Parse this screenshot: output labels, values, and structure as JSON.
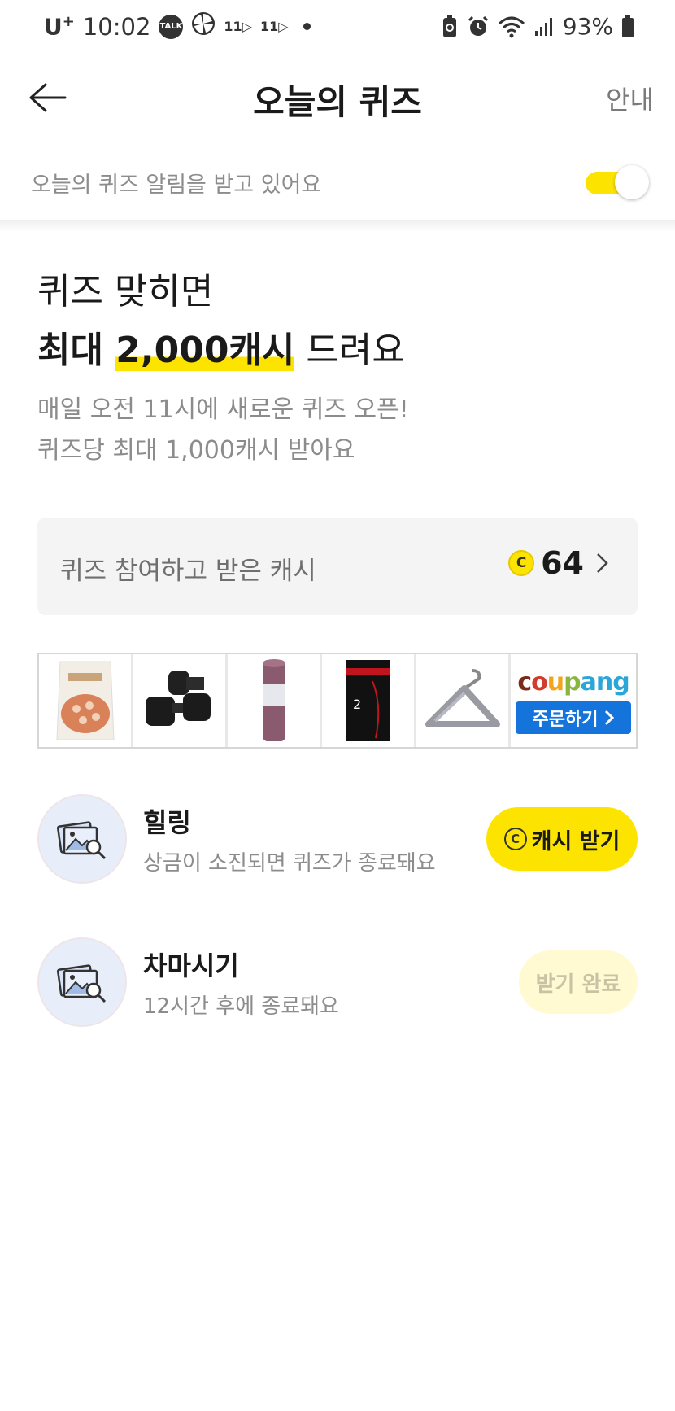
{
  "status_bar": {
    "carrier": "U",
    "carrier_sup": "+",
    "time": "10:02",
    "talk_icon_text": "TALK",
    "eleven_1": "11",
    "eleven_2": "11",
    "battery": "93%"
  },
  "header": {
    "title": "오늘의 퀴즈",
    "guide_label": "안내"
  },
  "notification": {
    "text": "오늘의 퀴즈 알림을 받고 있어요",
    "toggle_on": true
  },
  "hero": {
    "line1": "퀴즈 맞히면",
    "line2_prefix": "최대 ",
    "line2_highlight": "2,000캐시",
    "line2_suffix": " 드려요",
    "sub1": "매일 오전 11시에 새로운 퀴즈 오픈!",
    "sub2": "퀴즈당 최대 1,000캐시 받아요"
  },
  "cash_card": {
    "label": "퀴즈 참여하고 받은 캐시",
    "coin_symbol": "C",
    "value": "64"
  },
  "ad": {
    "brand_letters": [
      "c",
      "o",
      "u",
      "p",
      "a",
      "n",
      "g"
    ],
    "order_label": "주문하기"
  },
  "quizzes": [
    {
      "title": "힐링",
      "description": "상금이 소진되면 퀴즈가 종료돼요",
      "button_coin": "C",
      "button_label": "캐시 받기"
    },
    {
      "title": "차마시기",
      "description": "12시간 후에 종료돼요",
      "button_label": "받기 완료"
    }
  ],
  "colors": {
    "accent_yellow": "#fde400",
    "done_bg": "#fffad2",
    "coupang_blue": "#1574dc"
  }
}
